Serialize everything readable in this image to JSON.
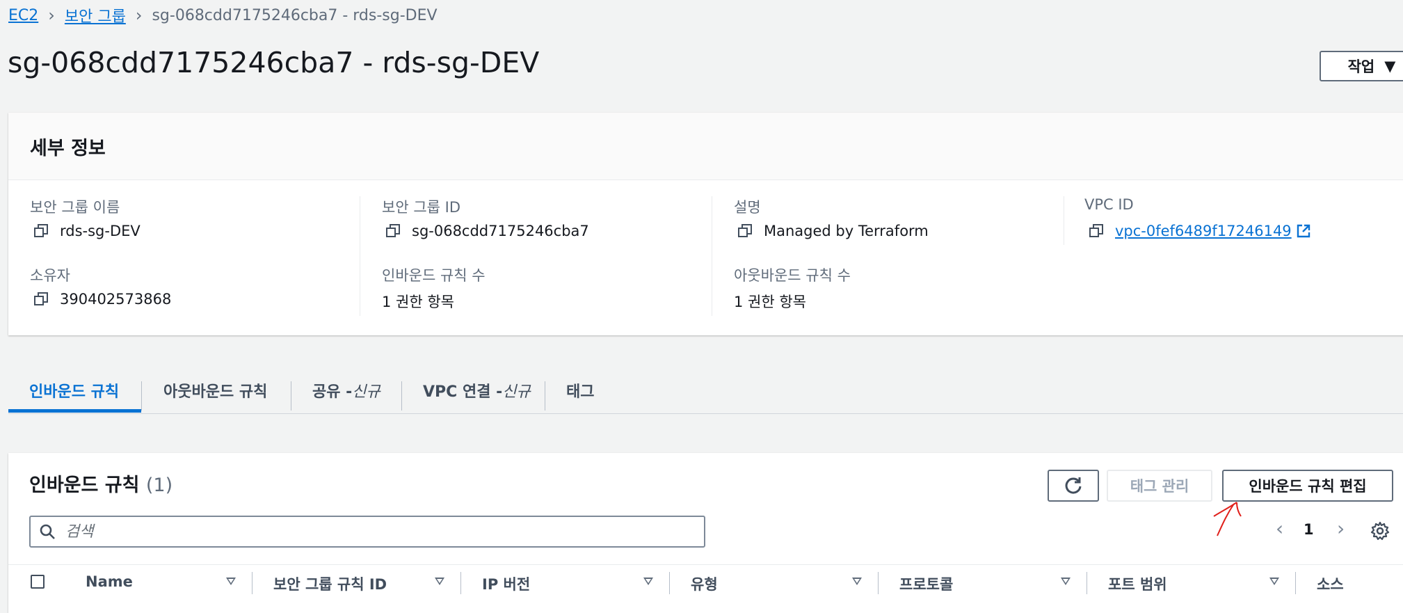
{
  "breadcrumb": {
    "items": [
      "EC2",
      "보안 그룹"
    ],
    "current": "sg-068cdd7175246cba7 - rds-sg-DEV"
  },
  "page_title": "sg-068cdd7175246cba7 - rds-sg-DEV",
  "actions_button": "작업",
  "details": {
    "title": "세부 정보",
    "sg_name_label": "보안 그룹 이름",
    "sg_name": "rds-sg-DEV",
    "sg_id_label": "보안 그룹 ID",
    "sg_id": "sg-068cdd7175246cba7",
    "desc_label": "설명",
    "desc": "Managed by Terraform",
    "vpc_label": "VPC ID",
    "vpc_id": "vpc-0fef6489f17246149",
    "owner_label": "소유자",
    "owner": "390402573868",
    "inbound_count_label": "인바운드 규칙 수",
    "inbound_count": "1 권한 항목",
    "outbound_count_label": "아웃바운드 규칙 수",
    "outbound_count": "1 권한 항목"
  },
  "tabs": {
    "inbound": "인바운드 규칙",
    "outbound": "아웃바운드 규칙",
    "sharing": "공유 - ",
    "sharing_new": "신규",
    "vpc_assoc": "VPC 연결 - ",
    "vpc_assoc_new": "신규",
    "tags": "태그"
  },
  "inbound": {
    "title": "인바운드 규칙",
    "count": "(1)",
    "manage_tags": "태그 관리",
    "edit_rules": "인바운드 규칙 편집",
    "search_placeholder": "검색",
    "page": "1",
    "columns": [
      "Name",
      "보안 그룹 규칙 ID",
      "IP 버전",
      "유형",
      "프로토콜",
      "포트 범위",
      "소스"
    ]
  },
  "colors": {
    "accent": "#0972d3",
    "annotation": "#e0201b"
  }
}
